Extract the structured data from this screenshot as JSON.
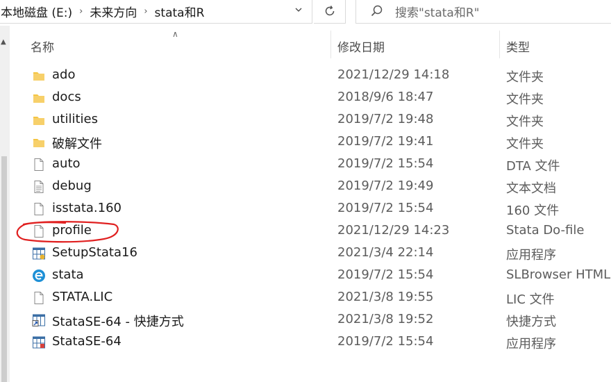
{
  "address": {
    "crumbs": [
      "本地磁盘 (E:)",
      "未来方向",
      "stata和R"
    ]
  },
  "search": {
    "placeholder": "搜索\"stata和R\""
  },
  "columns": {
    "name": "名称",
    "date": "修改日期",
    "type": "类型"
  },
  "files": [
    {
      "name": "ado",
      "date": "2021/12/29 14:18",
      "type": "文件夹",
      "icon": "folder-icon"
    },
    {
      "name": "docs",
      "date": "2018/9/6 18:47",
      "type": "文件夹",
      "icon": "folder-icon"
    },
    {
      "name": "utilities",
      "date": "2019/7/2 19:48",
      "type": "文件夹",
      "icon": "folder-icon"
    },
    {
      "name": "破解文件",
      "date": "2019/7/2 19:41",
      "type": "文件夹",
      "icon": "folder-icon"
    },
    {
      "name": "auto",
      "date": "2019/7/2 15:54",
      "type": "DTA 文件",
      "icon": "file-icon"
    },
    {
      "name": "debug",
      "date": "2019/7/2 19:49",
      "type": "文本文档",
      "icon": "text-file-icon"
    },
    {
      "name": "isstata.160",
      "date": "2019/7/2 15:54",
      "type": "160 文件",
      "icon": "file-icon"
    },
    {
      "name": "profile",
      "date": "2021/12/29 14:23",
      "type": "Stata Do-file",
      "icon": "file-icon"
    },
    {
      "name": "SetupStata16",
      "date": "2021/3/4 22:14",
      "type": "应用程序",
      "icon": "setup-app-icon"
    },
    {
      "name": "stata",
      "date": "2019/7/2 15:54",
      "type": "SLBrowser HTML D",
      "icon": "browser-icon"
    },
    {
      "name": "STATA.LIC",
      "date": "2021/3/8 19:55",
      "type": "LIC 文件",
      "icon": "file-icon"
    },
    {
      "name": "StataSE-64 - 快捷方式",
      "date": "2021/3/8 19:52",
      "type": "快捷方式",
      "icon": "shortcut-icon"
    },
    {
      "name": "StataSE-64",
      "date": "2019/7/2 15:54",
      "type": "应用程序",
      "icon": "app-icon"
    }
  ],
  "colors": {
    "folder": "#f4c542",
    "annotation": "#e02020",
    "app_blue": "#3a6ea5",
    "browser": "#1e90d6"
  }
}
